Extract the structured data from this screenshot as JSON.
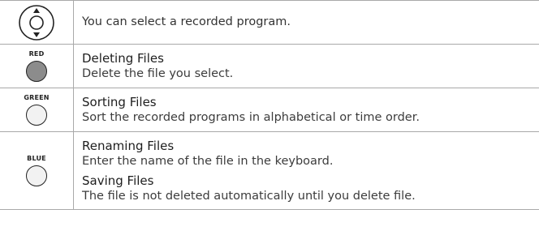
{
  "rows": [
    {
      "icon": "directional-pad-icon",
      "text": "You can select a recorded program."
    },
    {
      "button_label": "RED",
      "button_color": "#8c8c8c",
      "title": "Deleting Files",
      "desc": "Delete the file you select."
    },
    {
      "button_label": "GREEN",
      "button_color": "#f2f2f2",
      "title": "Sorting Files",
      "desc": "Sort the recorded programs in alphabetical or time order."
    },
    {
      "button_label": "BLUE",
      "button_color": "#f2f2f2",
      "items": [
        {
          "title": "Renaming Files",
          "desc": "Enter the name of the file in the keyboard."
        },
        {
          "title": "Saving Files",
          "desc": "The file is not deleted automatically until you delete file."
        }
      ]
    }
  ]
}
